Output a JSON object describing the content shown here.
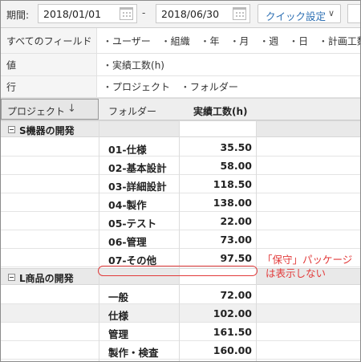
{
  "toolbar": {
    "period_label": "期間:",
    "start_date": "2018/01/01",
    "separator": "-",
    "end_date": "2018/06/30",
    "quick_settings_label": "クイック設定",
    "quick_settings_icon": "chevron-down-icon",
    "calendar_icon": "calendar-icon"
  },
  "fields": {
    "all_fields_label": "すべてのフィールド",
    "all_fields": [
      "ユーザー",
      "組織",
      "年",
      "月",
      "週",
      "日",
      "計画工数(h)"
    ],
    "values_label": "値",
    "values": [
      "実績工数(h)"
    ],
    "rows_label": "行",
    "rows": [
      "プロジェクト",
      "フォルダー"
    ]
  },
  "pivot": {
    "headers": {
      "project": "プロジェクト",
      "project_sort_icon": "↓",
      "folder": "フォルダー",
      "hours": "実績工数(h)"
    },
    "groups": [
      {
        "name": "S機器の開発",
        "rows": [
          {
            "folder": "01-仕様",
            "hours": "35.50"
          },
          {
            "folder": "02-基本設計",
            "hours": "58.00"
          },
          {
            "folder": "03-詳細設計",
            "hours": "118.50"
          },
          {
            "folder": "04-製作",
            "hours": "138.00"
          },
          {
            "folder": "05-テスト",
            "hours": "22.00"
          },
          {
            "folder": "06-管理",
            "hours": "73.00"
          },
          {
            "folder": "07-その他",
            "hours": "97.50"
          }
        ]
      },
      {
        "name": "L商品の開発",
        "rows": [
          {
            "folder": "一般",
            "hours": "72.00"
          },
          {
            "folder": "仕様",
            "hours": "102.00"
          },
          {
            "folder": "管理",
            "hours": "161.50"
          },
          {
            "folder": "製作・検査",
            "hours": "160.00"
          }
        ]
      }
    ]
  },
  "annotation": {
    "line1": "「保守」パッケージ",
    "line2": "は表示しない",
    "color": "#e23a3a"
  }
}
